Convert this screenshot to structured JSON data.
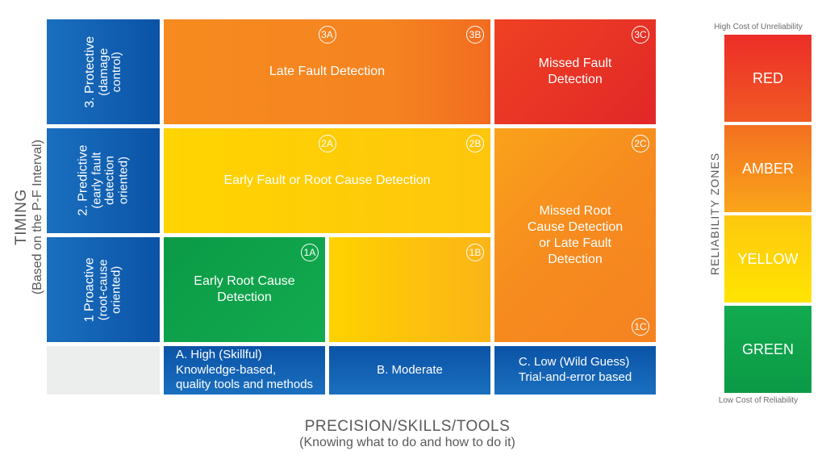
{
  "y_axis": {
    "title": "TIMING",
    "subtitle": "(Based on the P-F Interval)"
  },
  "x_axis": {
    "title": "PRECISION/SKILLS/TOOLS",
    "subtitle": "(Knowing what to do and how to do it)"
  },
  "rows": {
    "r3": {
      "major": "3. Protective",
      "minor": "(damage\ncontrol)"
    },
    "r2": {
      "major": "2. Predictive",
      "minor": "(early fault\ndetection\noriented)"
    },
    "r1": {
      "major": "1 Proactive",
      "minor": "(root-cause\noriented)"
    }
  },
  "cols": {
    "A": "A. High (Skillful)\nKnowledge-based,\nquality tools and methods",
    "B": "B. Moderate",
    "C": "C. Low (Wild Guess)\nTrial-and-error based"
  },
  "cells": {
    "c3AB": {
      "label": "Late Fault Detection",
      "badgeA": "3A",
      "badgeB": "3B"
    },
    "c3C": {
      "label": "Missed Fault\nDetection",
      "badge": "3C"
    },
    "c2AB": {
      "label": "Early Fault or Root Cause Detection",
      "badgeA": "2A",
      "badgeB": "2B"
    },
    "cRight": {
      "label": "Missed Root\nCause Detection\nor Late Fault\nDetection",
      "badgeTop": "2C",
      "badgeBot": "1C"
    },
    "c1A": {
      "label": "Early Root Cause\nDetection",
      "badge": "1A"
    },
    "c1B": {
      "badge": "1B"
    }
  },
  "legend": {
    "top_caption": "High Cost of Unreliability",
    "bottom_caption": "Low Cost of Reliability",
    "axis_label": "RELIABILITY ZONES",
    "items": [
      "RED",
      "AMBER",
      "YELLOW",
      "GREEN"
    ]
  },
  "chart_data": {
    "type": "table",
    "title": "Reliability Zones Matrix",
    "y_dimension": "Timing (Based on the P-F Interval)",
    "x_dimension": "Precision/Skills/Tools (Knowing what to do and how to do it)",
    "y_categories": [
      "1 Proactive (root-cause oriented)",
      "2. Predictive (early fault detection oriented)",
      "3. Protective (damage control)"
    ],
    "x_categories": [
      "A. High (Skillful) Knowledge-based, quality tools and methods",
      "B. Moderate",
      "C. Low (Wild Guess) Trial-and-error based"
    ],
    "cells": [
      {
        "id": "1A",
        "row": "1",
        "col": "A",
        "zone": "GREEN",
        "label": "Early Root Cause Detection"
      },
      {
        "id": "1B",
        "row": "1",
        "col": "B",
        "zone": "YELLOW",
        "label": "Early Fault or Root Cause Detection"
      },
      {
        "id": "1C",
        "row": "1",
        "col": "C",
        "zone": "AMBER",
        "label": "Missed Root Cause Detection or Late Fault Detection"
      },
      {
        "id": "2A",
        "row": "2",
        "col": "A",
        "zone": "YELLOW",
        "label": "Early Fault or Root Cause Detection"
      },
      {
        "id": "2B",
        "row": "2",
        "col": "B",
        "zone": "YELLOW",
        "label": "Early Fault or Root Cause Detection"
      },
      {
        "id": "2C",
        "row": "2",
        "col": "C",
        "zone": "AMBER",
        "label": "Missed Root Cause Detection or Late Fault Detection"
      },
      {
        "id": "3A",
        "row": "3",
        "col": "A",
        "zone": "AMBER",
        "label": "Late Fault Detection"
      },
      {
        "id": "3B",
        "row": "3",
        "col": "B",
        "zone": "AMBER",
        "label": "Late Fault Detection"
      },
      {
        "id": "3C",
        "row": "3",
        "col": "C",
        "zone": "RED",
        "label": "Missed Fault Detection"
      }
    ],
    "zone_order_low_to_high_cost": [
      "GREEN",
      "YELLOW",
      "AMBER",
      "RED"
    ]
  }
}
